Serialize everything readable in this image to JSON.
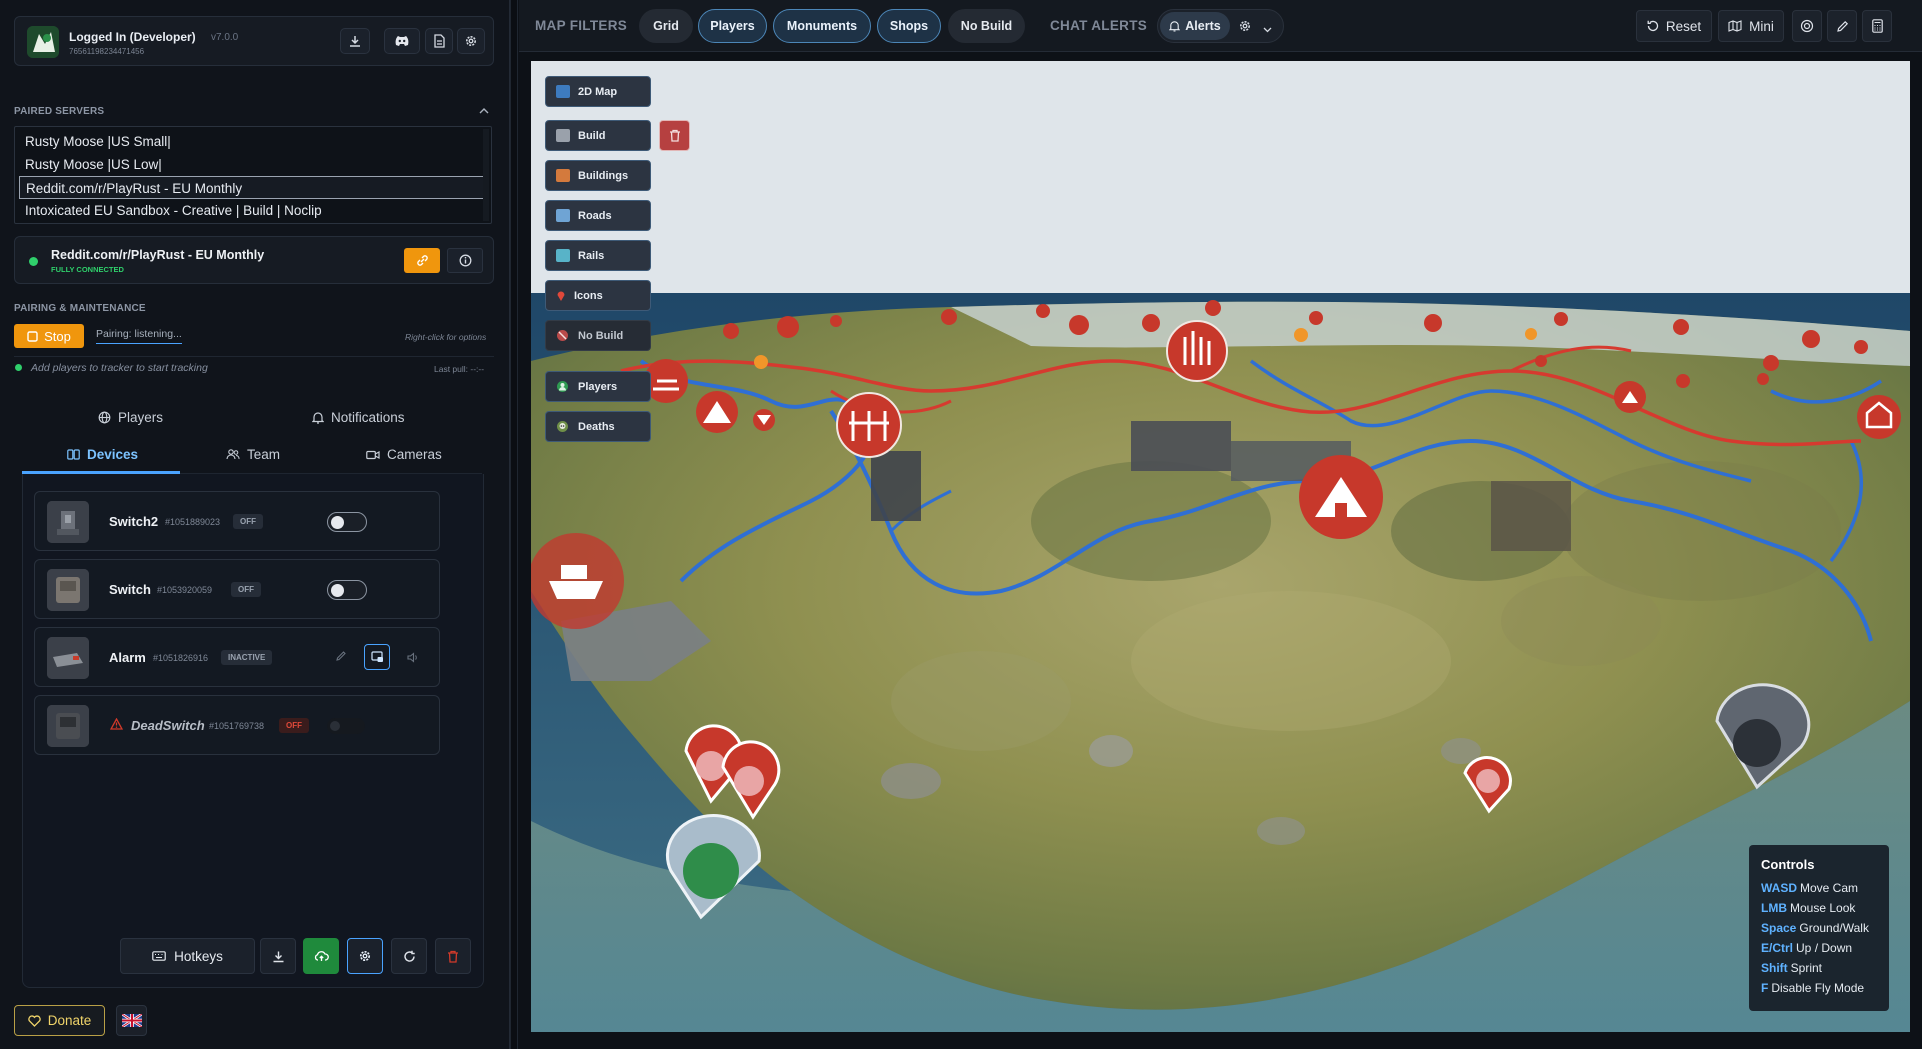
{
  "user": {
    "name": "Logged In (Developer)",
    "version": "v7.0.0",
    "steam_id": "76561198234471456"
  },
  "paired_servers": {
    "label": "PAIRED SERVERS",
    "items": [
      "Rusty Moose |US Small|",
      "Rusty Moose |US Low|",
      "Reddit.com/r/PlayRust - EU Monthly",
      "Intoxicated EU Sandbox - Creative | Build | Noclip"
    ],
    "selected_index": 2
  },
  "connection": {
    "server_name": "Reddit.com/r/PlayRust - EU Monthly",
    "status": "FULLY CONNECTED"
  },
  "pairing": {
    "label": "PAIRING & MAINTENANCE",
    "stop_label": "Stop",
    "status": "Pairing: listening...",
    "hint": "Right-click for options",
    "tracker_hint": "Add players to tracker to start tracking",
    "last_pull": "Last pull: --:--"
  },
  "tabs_top": {
    "players": "Players",
    "notifications": "Notifications"
  },
  "tabs_bottom": {
    "devices": "Devices",
    "team": "Team",
    "cameras": "Cameras"
  },
  "devices": [
    {
      "name": "Switch2",
      "id": "#1051889023",
      "badge": "OFF"
    },
    {
      "name": "Switch",
      "id": "#1053920059",
      "badge": "OFF"
    },
    {
      "name": "Alarm",
      "id": "#1051826916",
      "badge": "INACTIVE"
    },
    {
      "name": "DeadSwitch",
      "id": "#1051769738",
      "badge": "OFF"
    }
  ],
  "bottom_bar": {
    "hotkeys": "Hotkeys"
  },
  "footer": {
    "donate": "Donate"
  },
  "topbar": {
    "map_filters_label": "MAP FILTERS",
    "filters": [
      "Grid",
      "Players",
      "Monuments",
      "Shops",
      "No Build"
    ],
    "chat_alerts_label": "CHAT ALERTS",
    "alerts": "Alerts",
    "reset": "Reset",
    "mini": "Mini"
  },
  "map_layers": [
    "2D Map",
    "Build",
    "Buildings",
    "Roads",
    "Rails",
    "Icons",
    "No Build",
    "Players",
    "Deaths"
  ],
  "controls": {
    "title": "Controls",
    "rows": [
      {
        "key": "WASD",
        "action": "Move Cam"
      },
      {
        "key": "LMB",
        "action": "Mouse Look"
      },
      {
        "key": "Space",
        "action": "Ground/Walk"
      },
      {
        "key": "E/Ctrl",
        "action": "Up / Down"
      },
      {
        "key": "Shift",
        "action": "Sprint"
      },
      {
        "key": "F",
        "action": "Disable Fly Mode"
      }
    ]
  },
  "colors": {
    "accent_blue": "#4aa3ff",
    "accent_orange": "#f0960d",
    "connected_green": "#2fcf6b",
    "danger_red": "#d23a2a",
    "monument_red": "#c0392b"
  }
}
